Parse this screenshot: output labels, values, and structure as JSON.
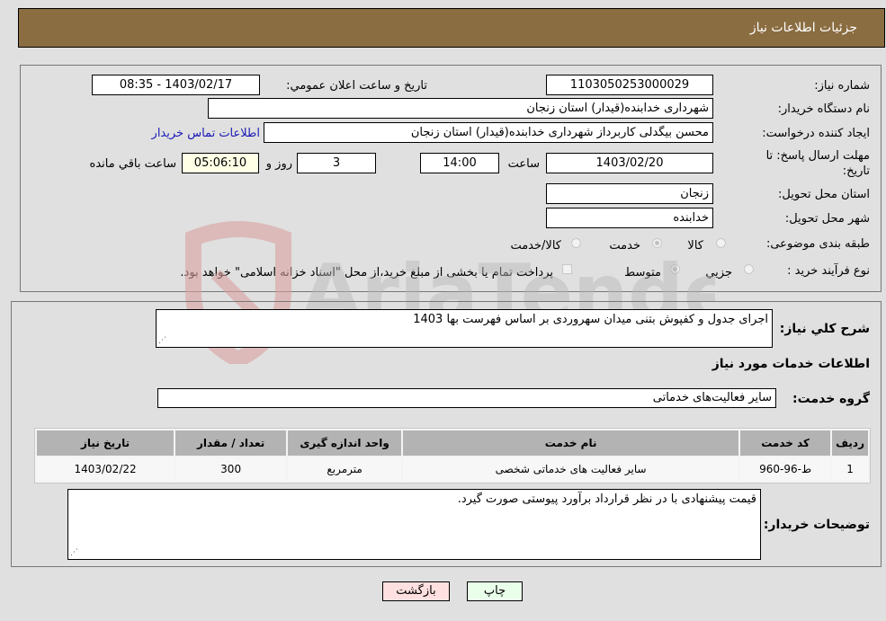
{
  "header": {
    "title": "جزئیات اطلاعات نیاز"
  },
  "details": {
    "need_number_label": "شماره نیاز:",
    "need_number": "1103050253000029",
    "announce_label": "تاریخ و ساعت اعلان عمومي:",
    "announce_value": "1403/02/17 - 08:35",
    "buyer_org_label": "نام دستگاه خریدار:",
    "buyer_org": "شهرداری خدابنده(قیدار) استان زنجان",
    "creator_label": "ایجاد کننده درخواست:",
    "creator": "محسن بیگدلی کاربرداز شهرداری خدابنده(قیدار) استان زنجان",
    "contact_link": "اطلاعات تماس خریدار",
    "deadline_label_1": "مهلت ارسال پاسخ: تا",
    "deadline_label_2": "تاریخ:",
    "deadline_date": "1403/02/20",
    "time_label": "ساعت",
    "deadline_time": "14:00",
    "days_value": "3",
    "days_label": "روز و",
    "remaining_time": "05:06:10",
    "remaining_label": "ساعت باقي مانده",
    "province_label": "استان محل تحویل:",
    "province": "زنجان",
    "city_label": "شهر محل تحویل:",
    "city": "خدابنده",
    "category_label": "طبقه بندی موضوعی:",
    "category_options": [
      {
        "label": "کالا",
        "checked": false
      },
      {
        "label": "خدمت",
        "checked": true
      },
      {
        "label": "کالا/خدمت",
        "checked": false
      }
    ],
    "process_label": "نوع فرآیند خرید :",
    "process_options": [
      {
        "label": "جزيي",
        "checked": false
      },
      {
        "label": "متوسط",
        "checked": true
      }
    ],
    "treasury_note": "پرداخت تمام یا بخشی از مبلغ خرید،از محل \"اسناد خزانه اسلامی\" خواهد بود.",
    "treasury_checked": false
  },
  "services": {
    "description_label": "شرح کلي نیاز:",
    "description": "اجرای جدول و کفپوش بتنی میدان سهروردی بر اساس فهرست بها 1403",
    "section_title": "اطلاعات خدمات مورد نیاز",
    "group_label": "گروه خدمت:",
    "group_value": "سایر فعالیت‌های خدماتی",
    "table": {
      "headers": [
        "ردیف",
        "کد خدمت",
        "نام خدمت",
        "واحد اندازه گیری",
        "تعداد / مقدار",
        "تاریخ نیاز"
      ],
      "rows": [
        [
          "1",
          "ط-96-960",
          "سایر فعالیت های خدماتی شخصی",
          "مترمربع",
          "300",
          "1403/02/22"
        ]
      ]
    },
    "buyer_notes_label": "توضیحات خریدار:",
    "buyer_notes": "قیمت پیشنهادی با در نظر قرارداد برآورد پیوستی صورت گیرد."
  },
  "buttons": {
    "print": "چاپ",
    "back": "بازگشت"
  },
  "colors": {
    "header_bg": "#8b6d42",
    "print_bg": "#eaffea",
    "back_bg": "#ffe0e0"
  },
  "watermark": {
    "text": "AriaTender.neT"
  }
}
